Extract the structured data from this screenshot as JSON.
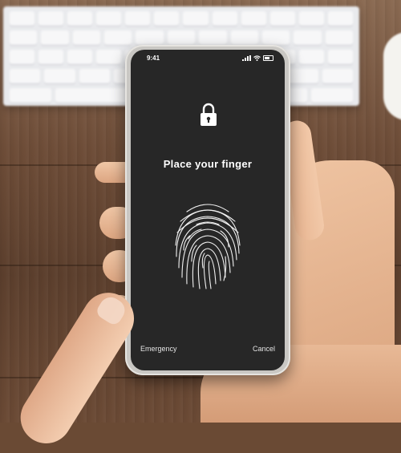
{
  "status_bar": {
    "time": "9:41"
  },
  "lock_screen": {
    "title": "Place your finger",
    "emergency_label": "Emergency",
    "cancel_label": "Cancel"
  },
  "icons": {
    "lock": "lock-icon",
    "fingerprint": "fingerprint-icon",
    "signal": "signal-icon",
    "wifi": "wifi-icon",
    "battery": "battery-icon"
  },
  "colors": {
    "screen_background": "#272727",
    "text": "#ffffff"
  }
}
